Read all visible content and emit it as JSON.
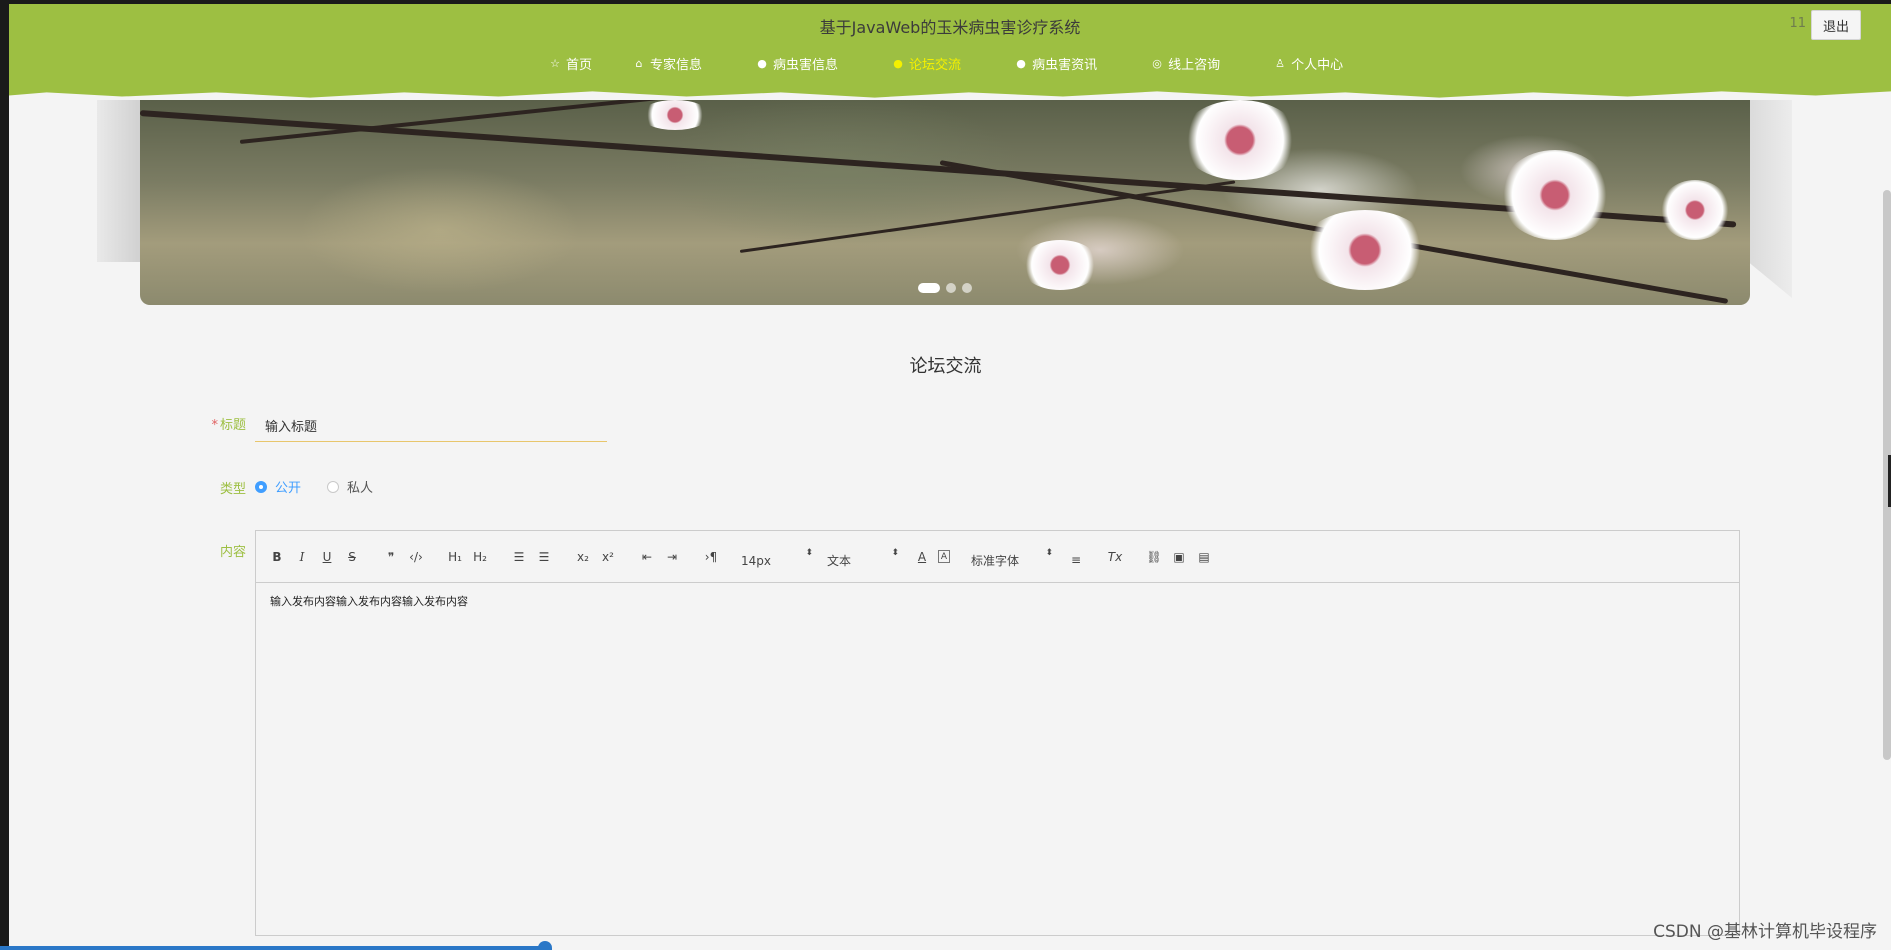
{
  "header": {
    "site_title": "基于JavaWeb的玉米病虫害诊疗系统",
    "user_id": "11",
    "logout_label": "退出",
    "bg_color": "#9dbf42",
    "nav": [
      {
        "label": "首页",
        "icon": "star-icon",
        "glyph": "☆",
        "active": false
      },
      {
        "label": "专家信息",
        "icon": "bag-icon",
        "glyph": "⌂",
        "active": false
      },
      {
        "label": "病虫害信息",
        "icon": "info-circle-icon",
        "glyph": "●",
        "active": false
      },
      {
        "label": "论坛交流",
        "icon": "info-circle-icon",
        "glyph": "●",
        "active": true
      },
      {
        "label": "病虫害资讯",
        "icon": "info-circle-icon",
        "glyph": "●",
        "active": false
      },
      {
        "label": "线上咨询",
        "icon": "globe-icon",
        "glyph": "◎",
        "active": false
      },
      {
        "label": "个人中心",
        "icon": "user-icon",
        "glyph": "♙",
        "active": false
      }
    ]
  },
  "banner": {
    "slides": 3,
    "active_slide": 1
  },
  "form": {
    "section_title": "论坛交流",
    "title_label": "标题",
    "title_required_mark": "*",
    "title_value": "输入标题",
    "type_label": "类型",
    "type_options": [
      {
        "label": "公开",
        "checked": true
      },
      {
        "label": "私人",
        "checked": false
      }
    ],
    "content_label": "内容",
    "editor": {
      "toolbar": {
        "bold": "B",
        "italic": "I",
        "underline": "U",
        "strike": "S",
        "quote": "❞",
        "code": "‹/›",
        "h1": "H₁",
        "h2": "H₂",
        "ordered_list": "☰",
        "bullet_list": "☰",
        "subscript": "x₂",
        "superscript": "x²",
        "outdent": "⇤",
        "indent": "⇥",
        "direction": "›¶",
        "font_size": "14px",
        "heading": "文本",
        "font_family": "标准字体",
        "color": "A",
        "background": "A",
        "align": "≡",
        "clean": "Tx",
        "link": "⛓",
        "image": "▣",
        "video": "▤"
      },
      "content": "输入发布内容输入发布内容输入发布内容"
    }
  },
  "watermark": "CSDN @基林计算机毕设程序"
}
